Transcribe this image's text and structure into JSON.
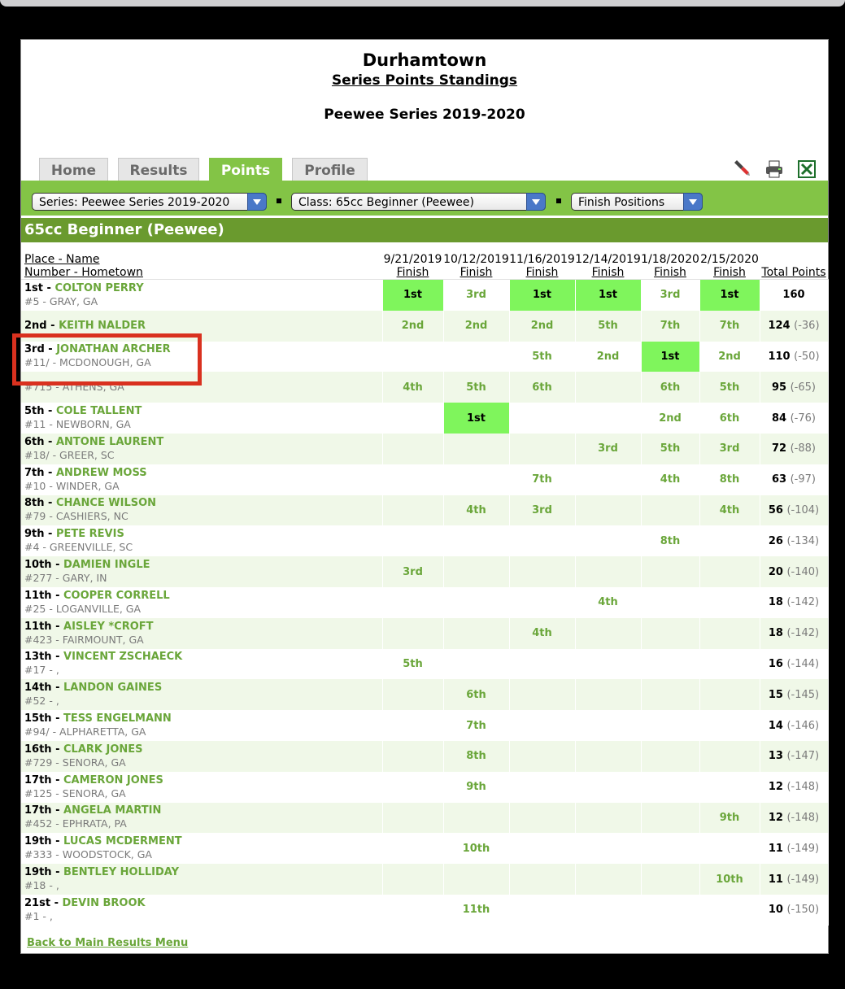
{
  "header": {
    "org": "Durhamtown",
    "subtitle": "Series Points Standings",
    "series": "Peewee Series 2019-2020"
  },
  "tabs": [
    {
      "label": "Home"
    },
    {
      "label": "Results"
    },
    {
      "label": "Points"
    },
    {
      "label": "Profile"
    }
  ],
  "tools": [
    "flashlight-icon",
    "printer-icon",
    "excel-icon"
  ],
  "filters": {
    "series": "Series: Peewee Series 2019-2020",
    "class": "Class: 65cc Beginner (Peewee)",
    "mode": "Finish Positions"
  },
  "class_title": "65cc Beginner (Peewee)",
  "columns": {
    "name_line1": "Place - Name",
    "name_line2": "Number - Hometown",
    "dates": [
      "9/21/2019",
      "10/12/2019",
      "11/16/2019",
      "12/14/2019",
      "1/18/2020",
      "2/15/2020"
    ],
    "finish": "Finish",
    "total": "Total Points"
  },
  "rows": [
    {
      "place": "1st",
      "name": "COLTON PERRY",
      "hometown": "#5 - GRAY, GA",
      "finishes": [
        "1st",
        "3rd",
        "1st",
        "1st",
        "3rd",
        "1st"
      ],
      "highlight": [
        true,
        false,
        true,
        true,
        false,
        true
      ],
      "total": "160",
      "diff": ""
    },
    {
      "place": "2nd",
      "name": "KEITH NALDER",
      "hometown": "",
      "finishes": [
        "2nd",
        "2nd",
        "2nd",
        "5th",
        "7th",
        "7th"
      ],
      "highlight": [
        false,
        false,
        false,
        false,
        false,
        false
      ],
      "total": "124",
      "diff": "(-36)"
    },
    {
      "place": "3rd",
      "name": "JONATHAN ARCHER",
      "hometown": "#11/ - MCDONOUGH, GA",
      "finishes": [
        "",
        "",
        "5th",
        "2nd",
        "1st",
        "2nd"
      ],
      "highlight": [
        false,
        false,
        false,
        false,
        true,
        false
      ],
      "total": "110",
      "diff": "(-50)"
    },
    {
      "place": "",
      "name": "",
      "hometown": "#715 - ATHENS, GA",
      "finishes": [
        "4th",
        "5th",
        "6th",
        "",
        "6th",
        "5th"
      ],
      "highlight": [
        false,
        false,
        false,
        false,
        false,
        false
      ],
      "total": "95",
      "diff": "(-65)"
    },
    {
      "place": "5th",
      "name": "COLE TALLENT",
      "hometown": "#11 - NEWBORN, GA",
      "finishes": [
        "",
        "1st",
        "",
        "",
        "2nd",
        "6th"
      ],
      "highlight": [
        false,
        true,
        false,
        false,
        false,
        false
      ],
      "total": "84",
      "diff": "(-76)"
    },
    {
      "place": "6th",
      "name": "ANTONE LAURENT",
      "hometown": "#18/ - GREER, SC",
      "finishes": [
        "",
        "",
        "",
        "3rd",
        "5th",
        "3rd"
      ],
      "highlight": [
        false,
        false,
        false,
        false,
        false,
        false
      ],
      "total": "72",
      "diff": "(-88)"
    },
    {
      "place": "7th",
      "name": "ANDREW MOSS",
      "hometown": "#10 - WINDER, GA",
      "finishes": [
        "",
        "",
        "7th",
        "",
        "4th",
        "8th"
      ],
      "highlight": [
        false,
        false,
        false,
        false,
        false,
        false
      ],
      "total": "63",
      "diff": "(-97)"
    },
    {
      "place": "8th",
      "name": "CHANCE WILSON",
      "hometown": "#79 - CASHIERS, NC",
      "finishes": [
        "",
        "4th",
        "3rd",
        "",
        "",
        "4th"
      ],
      "highlight": [
        false,
        false,
        false,
        false,
        false,
        false
      ],
      "total": "56",
      "diff": "(-104)"
    },
    {
      "place": "9th",
      "name": "PETE REVIS",
      "hometown": "#4 - GREENVILLE, SC",
      "finishes": [
        "",
        "",
        "",
        "",
        "8th",
        ""
      ],
      "highlight": [
        false,
        false,
        false,
        false,
        false,
        false
      ],
      "total": "26",
      "diff": "(-134)"
    },
    {
      "place": "10th",
      "name": "DAMIEN INGLE",
      "hometown": "#277 - GARY, IN",
      "finishes": [
        "3rd",
        "",
        "",
        "",
        "",
        ""
      ],
      "highlight": [
        false,
        false,
        false,
        false,
        false,
        false
      ],
      "total": "20",
      "diff": "(-140)"
    },
    {
      "place": "11th",
      "name": "COOPER CORRELL",
      "hometown": "#25 - LOGANVILLE, GA",
      "finishes": [
        "",
        "",
        "",
        "4th",
        "",
        ""
      ],
      "highlight": [
        false,
        false,
        false,
        false,
        false,
        false
      ],
      "total": "18",
      "diff": "(-142)"
    },
    {
      "place": "11th",
      "name": "AISLEY *CROFT",
      "hometown": "#423 - FAIRMOUNT, GA",
      "finishes": [
        "",
        "",
        "4th",
        "",
        "",
        ""
      ],
      "highlight": [
        false,
        false,
        false,
        false,
        false,
        false
      ],
      "total": "18",
      "diff": "(-142)"
    },
    {
      "place": "13th",
      "name": "VINCENT ZSCHAECK",
      "hometown": "#17 - ,",
      "finishes": [
        "5th",
        "",
        "",
        "",
        "",
        ""
      ],
      "highlight": [
        false,
        false,
        false,
        false,
        false,
        false
      ],
      "total": "16",
      "diff": "(-144)"
    },
    {
      "place": "14th",
      "name": "LANDON GAINES",
      "hometown": "#52 - ,",
      "finishes": [
        "",
        "6th",
        "",
        "",
        "",
        ""
      ],
      "highlight": [
        false,
        false,
        false,
        false,
        false,
        false
      ],
      "total": "15",
      "diff": "(-145)"
    },
    {
      "place": "15th",
      "name": "TESS ENGELMANN",
      "hometown": "#94/ - ALPHARETTA, GA",
      "finishes": [
        "",
        "7th",
        "",
        "",
        "",
        ""
      ],
      "highlight": [
        false,
        false,
        false,
        false,
        false,
        false
      ],
      "total": "14",
      "diff": "(-146)"
    },
    {
      "place": "16th",
      "name": "CLARK JONES",
      "hometown": "#729 - SENORA, GA",
      "finishes": [
        "",
        "8th",
        "",
        "",
        "",
        ""
      ],
      "highlight": [
        false,
        false,
        false,
        false,
        false,
        false
      ],
      "total": "13",
      "diff": "(-147)"
    },
    {
      "place": "17th",
      "name": "CAMERON JONES",
      "hometown": "#125 - SENORA, GA",
      "finishes": [
        "",
        "9th",
        "",
        "",
        "",
        ""
      ],
      "highlight": [
        false,
        false,
        false,
        false,
        false,
        false
      ],
      "total": "12",
      "diff": "(-148)"
    },
    {
      "place": "17th",
      "name": "ANGELA MARTIN",
      "hometown": "#452 - EPHRATA, PA",
      "finishes": [
        "",
        "",
        "",
        "",
        "",
        "9th"
      ],
      "highlight": [
        false,
        false,
        false,
        false,
        false,
        false
      ],
      "total": "12",
      "diff": "(-148)"
    },
    {
      "place": "19th",
      "name": "LUCAS MCDERMENT",
      "hometown": "#333 - WOODSTOCK, GA",
      "finishes": [
        "",
        "10th",
        "",
        "",
        "",
        ""
      ],
      "highlight": [
        false,
        false,
        false,
        false,
        false,
        false
      ],
      "total": "11",
      "diff": "(-149)"
    },
    {
      "place": "19th",
      "name": "BENTLEY HOLLIDAY",
      "hometown": "#18 - ,",
      "finishes": [
        "",
        "",
        "",
        "",
        "",
        "10th"
      ],
      "highlight": [
        false,
        false,
        false,
        false,
        false,
        false
      ],
      "total": "11",
      "diff": "(-149)"
    },
    {
      "place": "21st",
      "name": "DEVIN BROOK",
      "hometown": "#1 - ,",
      "finishes": [
        "",
        "11th",
        "",
        "",
        "",
        ""
      ],
      "highlight": [
        false,
        false,
        false,
        false,
        false,
        false
      ],
      "total": "10",
      "diff": "(-150)"
    }
  ],
  "back_link": "Back to Main Results Menu",
  "colors": {
    "accent": "#83c446",
    "class_bar": "#6a9a2e",
    "highlight": "#7ff55c",
    "annotation": "#d9311f"
  }
}
